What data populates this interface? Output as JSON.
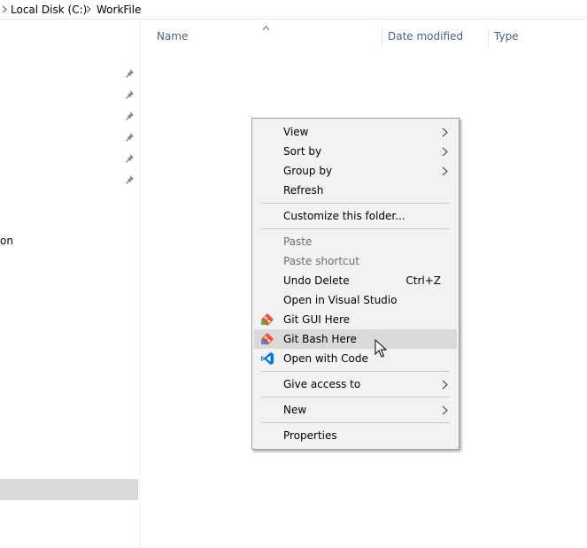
{
  "breadcrumb": {
    "items": [
      "Local Disk (C:)",
      "WorkFile"
    ]
  },
  "nav": {
    "partial_label": "on"
  },
  "columns": {
    "name": "Name",
    "date_modified": "Date modified",
    "type": "Type"
  },
  "context_menu": {
    "view": "View",
    "sort_by": "Sort by",
    "group_by": "Group by",
    "refresh": "Refresh",
    "customize": "Customize this folder...",
    "paste": "Paste",
    "paste_shortcut": "Paste shortcut",
    "undo_delete": "Undo Delete",
    "undo_shortcut": "Ctrl+Z",
    "open_visual_studio": "Open in Visual Studio",
    "git_gui": "Git GUI Here",
    "git_bash": "Git Bash Here",
    "open_with_code": "Open with Code",
    "give_access": "Give access to",
    "new": "New",
    "properties": "Properties"
  },
  "icons": {
    "git": "git-icon",
    "vscode": "vscode-icon",
    "pin": "pin-icon"
  },
  "colors": {
    "git": "#f05033",
    "vscode": "#0078d4",
    "hover": "#d9d9d9",
    "header_text": "#4c607a"
  }
}
